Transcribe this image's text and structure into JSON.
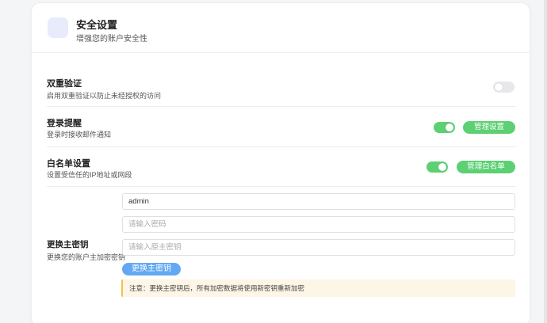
{
  "header": {
    "title": "安全设置",
    "subtitle": "增强您的账户安全性"
  },
  "two_factor": {
    "title": "双重验证",
    "desc": "启用双重验证以防止未经授权的访问",
    "enabled": false
  },
  "login_alert": {
    "title": "登录提醒",
    "desc": "登录时接收邮件通知",
    "enabled": true,
    "button": "管理设置"
  },
  "whitelist": {
    "title": "白名单设置",
    "desc": "设置受信任的IP地址或网段",
    "enabled": true,
    "button": "管理白名单"
  },
  "master_key": {
    "title": "更换主密钥",
    "desc": "更换您的账户主加密密钥",
    "username_value": "admin",
    "password_placeholder": "请输入密码",
    "old_key_placeholder": "请输入原主密钥",
    "submit_label": "更换主密钥",
    "notice": "注意：更换主密钥后，所有加密数据将使用新密钥重新加密"
  },
  "colors": {
    "accent_green": "#5cd073",
    "accent_blue": "#62a8f3",
    "notice_bg": "#fdf6e6",
    "notice_border": "#f2c04f"
  }
}
